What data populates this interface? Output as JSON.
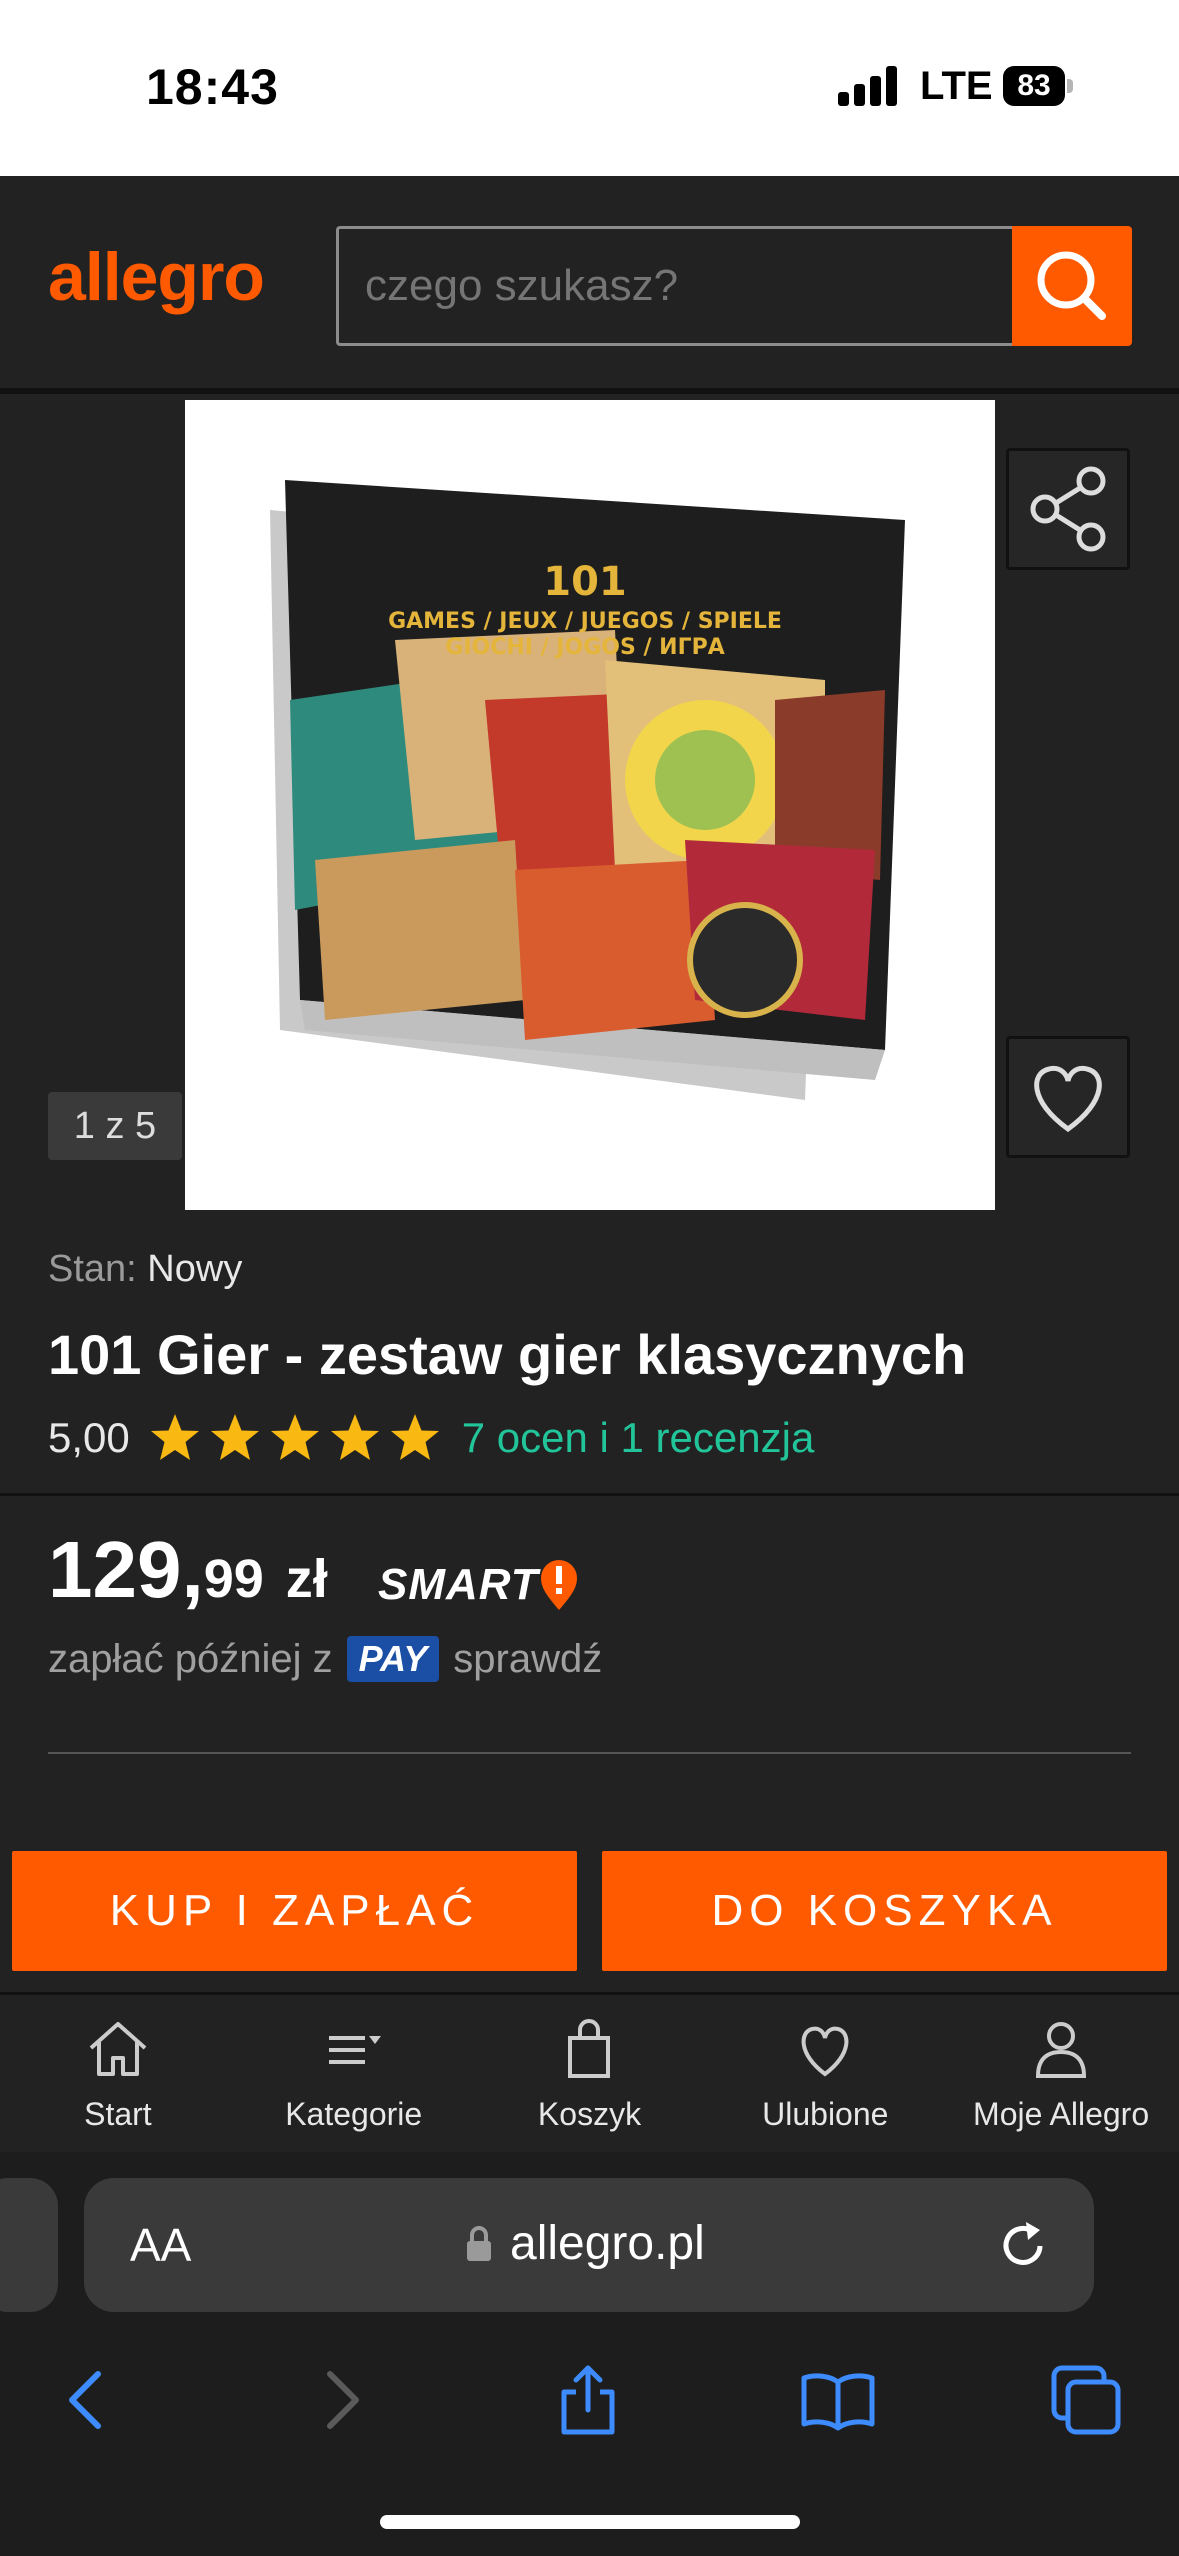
{
  "status_bar": {
    "time": "18:43",
    "network": "LTE",
    "battery": "83"
  },
  "header": {
    "logo": "allegro",
    "search_placeholder": "czego szukasz?"
  },
  "gallery": {
    "counter": "1 z 5"
  },
  "product": {
    "condition_label": "Stan:",
    "condition_value": "Nowy",
    "title": "101 Gier - zestaw gier klasycznych",
    "rating_value": "5,00",
    "stars": 5,
    "reviews_link": "7 ocen i 1 recenzja",
    "price_int": "129,",
    "price_dec": "99",
    "currency": "zł",
    "smart_label": "SMART",
    "paylater_prefix": "zapłać później z",
    "pay_badge": "PAY",
    "paylater_link": "sprawdź"
  },
  "actions": {
    "buy_now": "KUP I ZAPŁAĆ",
    "add_to_cart": "DO KOSZYKA"
  },
  "bottom_nav": [
    {
      "label": "Start",
      "icon": "home-icon"
    },
    {
      "label": "Kategorie",
      "icon": "menu-icon"
    },
    {
      "label": "Koszyk",
      "icon": "bag-icon"
    },
    {
      "label": "Ulubione",
      "icon": "heart-icon"
    },
    {
      "label": "Moje Allegro",
      "icon": "user-icon"
    }
  ],
  "browser": {
    "aa_label": "AA",
    "url": "allegro.pl"
  },
  "colors": {
    "brand": "#ff5a00",
    "link": "#22c59a",
    "star": "#f9b812",
    "pay": "#1b4fa6"
  }
}
